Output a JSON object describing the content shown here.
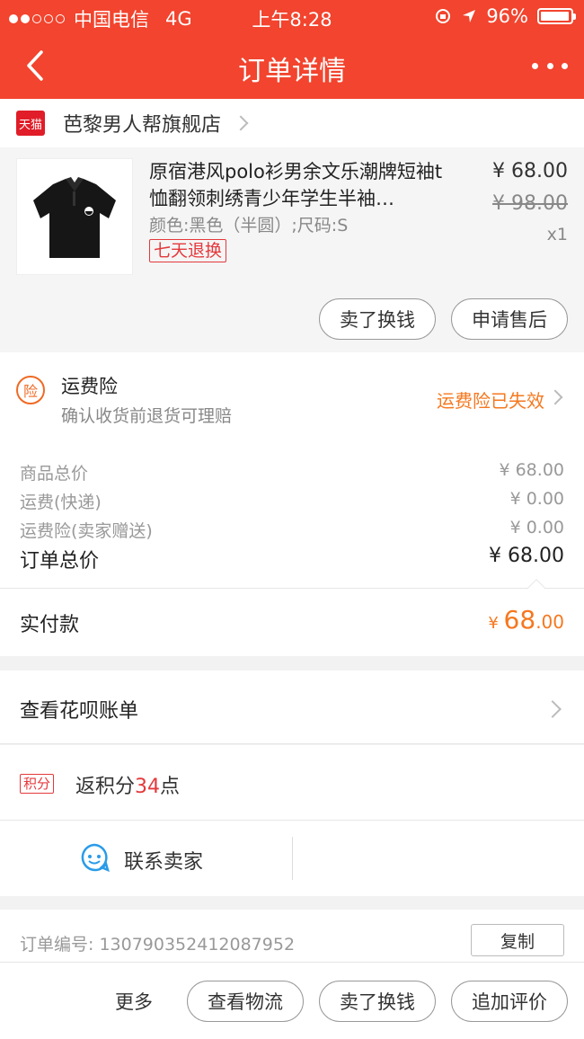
{
  "status_bar": {
    "carrier": "中国电信",
    "network": "4G",
    "time": "上午8:28",
    "battery": "96%",
    "battery_level": 0.96
  },
  "nav": {
    "title": "订单详情"
  },
  "shop": {
    "logo_text": "天猫",
    "name": "芭黎男人帮旗舰店"
  },
  "product": {
    "name": "原宿港风polo衫男余文乐潮牌短袖t恤翻领刺绣青少年学生半袖…",
    "variant": "颜色:黑色（半圆）;尺码:S",
    "tag": "七天退换",
    "price": "¥ 68.00",
    "original_price": "¥ 98.00",
    "quantity": "x1",
    "buttons": {
      "sell": "卖了换钱",
      "after_sale": "申请售后"
    }
  },
  "insurance": {
    "icon_text": "险",
    "title": "运费险",
    "subtitle": "确认收货前退货可理赔",
    "status": "运费险已失效"
  },
  "costs": [
    {
      "label": "商品总价",
      "value": "¥ 68.00"
    },
    {
      "label": "运费(快递)",
      "value": "¥ 0.00"
    },
    {
      "label": "运费险(卖家赠送)",
      "value": "¥ 0.00"
    },
    {
      "label": "订单总价",
      "value": "¥ 68.00"
    }
  ],
  "paid": {
    "label": "实付款",
    "currency": "¥ ",
    "integer": "68",
    "decimal": ".00"
  },
  "huabei": {
    "label": "查看花呗账单"
  },
  "points": {
    "badge": "积分",
    "prefix": "返积分",
    "number": "34",
    "suffix": "点"
  },
  "contact": {
    "label": "联系卖家"
  },
  "order": {
    "label": "订单编号:   13079035241208795​2",
    "copy": "复制"
  },
  "bottom_bar": {
    "more": "更多",
    "logistics": "查看物流",
    "sell": "卖了换钱",
    "review": "追加评价"
  },
  "colors": {
    "brand_red": "#f2442e",
    "accent_orange": "#f5781f",
    "tmall_red": "#e01d28"
  }
}
